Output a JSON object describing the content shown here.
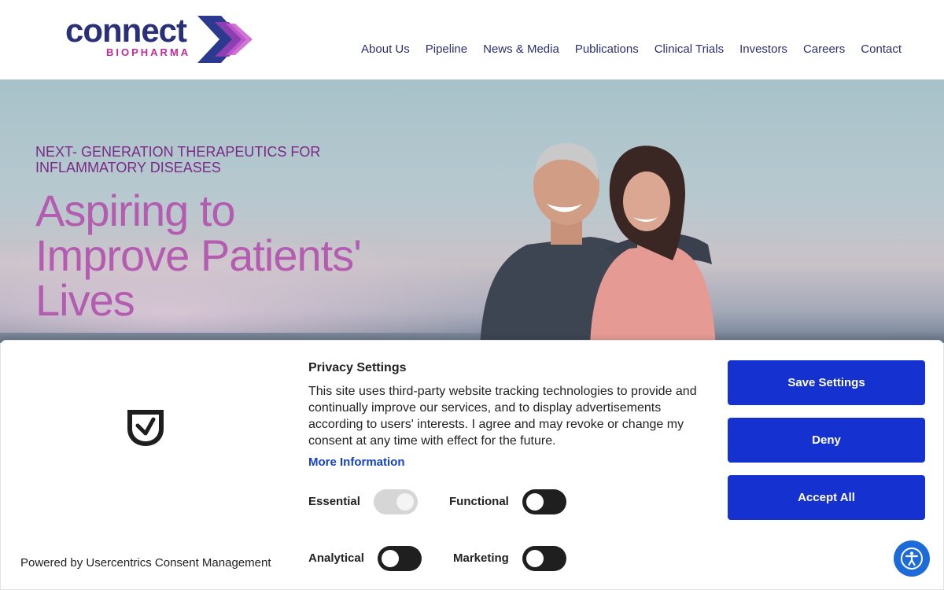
{
  "brand": {
    "logo_word": "connect",
    "logo_sub": "BIOPHARMA"
  },
  "nav": {
    "items": [
      "About Us",
      "Pipeline",
      "News & Media",
      "Publications",
      "Clinical Trials",
      "Investors",
      "Careers",
      "Contact"
    ]
  },
  "hero": {
    "eyebrow": "NEXT- GENERATION THERAPEUTICS FOR INFLAMMATORY DISEASES",
    "headline": "Aspiring to Improve Patients' Lives"
  },
  "consent": {
    "title": "Privacy Settings",
    "body": "This site uses third-party website tracking technologies to provide and continually improve our services, and to display advertisements according to users' interests. I agree and may revoke or change my consent at any time with effect for the future.",
    "more_info": "More Information",
    "powered_by": "Powered by Usercentrics Consent Management",
    "toggles": {
      "essential": {
        "label": "Essential",
        "enabled": true,
        "locked": true
      },
      "functional": {
        "label": "Functional",
        "enabled": false
      },
      "analytical": {
        "label": "Analytical",
        "enabled": false
      },
      "marketing": {
        "label": "Marketing",
        "enabled": false
      }
    },
    "buttons": {
      "save": "Save Settings",
      "deny": "Deny",
      "accept": "Accept All"
    }
  },
  "icons": {
    "consent_logo": "shield-check-icon",
    "accessibility": "accessibility-icon"
  },
  "colors": {
    "brand_navy": "#2a2f7a",
    "brand_magenta": "#c4289c",
    "button_blue": "#1532d0",
    "link_blue": "#1640c8",
    "headline_pink": "#b45cb0",
    "eyebrow_purple": "#7a2a86"
  }
}
